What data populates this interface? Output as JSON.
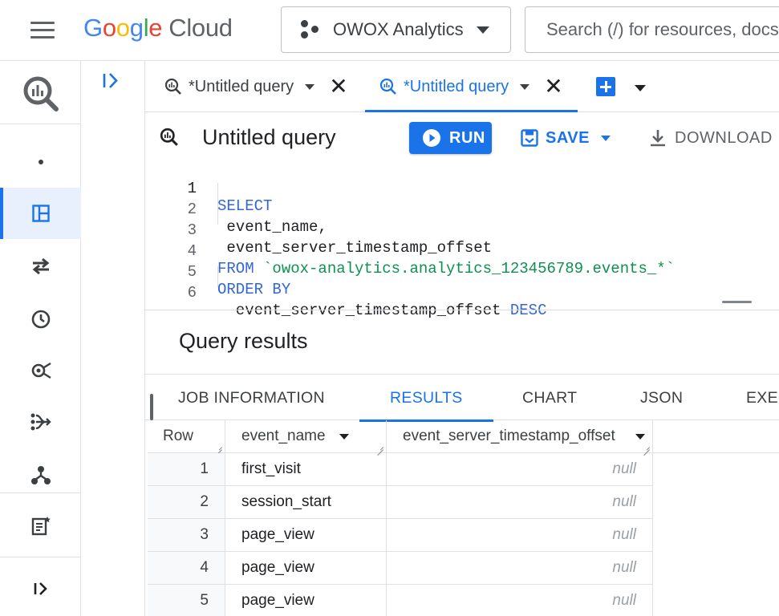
{
  "header": {
    "logo_google": "Google",
    "logo_cloud": "Cloud",
    "project_name": "OWOX Analytics",
    "search_placeholder": "Search (/) for resources, docs"
  },
  "rail": {
    "icons": [
      "bigquery-logo-icon",
      "dot-icon",
      "dashboard-icon",
      "transfers-icon",
      "scheduled-queries-icon",
      "analytics-hub-icon",
      "dataform-icon",
      "pipelines-icon",
      "notes-icon",
      "expand-icon"
    ],
    "active_index": 2
  },
  "tabs": [
    {
      "label": "*Untitled query",
      "active": false
    },
    {
      "label": "*Untitled query",
      "active": true
    }
  ],
  "editor": {
    "title": "Untitled query",
    "run_label": "RUN",
    "save_label": "SAVE",
    "download_label": "DOWNLOAD",
    "lines": [
      {
        "n": "1",
        "text": "SELECT"
      },
      {
        "n": "2",
        "text": " event_name,"
      },
      {
        "n": "3",
        "text": " event_server_timestamp_offset"
      },
      {
        "n": "4",
        "text": "FROM `owox-analytics.analytics_123456789.events_*`"
      },
      {
        "n": "5",
        "text": "ORDER BY"
      },
      {
        "n": "6",
        "text": "  event_server_timestamp_offset DESC"
      }
    ]
  },
  "results": {
    "title": "Query results",
    "tabs": [
      "JOB INFORMATION",
      "RESULTS",
      "CHART",
      "JSON",
      "EXECUTION DETAILS"
    ],
    "active_tab": "RESULTS",
    "columns": [
      "Row",
      "event_name",
      "event_server_timestamp_offset"
    ],
    "rows": [
      {
        "row": "1",
        "event_name": "first_visit",
        "offset": "null"
      },
      {
        "row": "2",
        "event_name": "session_start",
        "offset": "null"
      },
      {
        "row": "3",
        "event_name": "page_view",
        "offset": "null"
      },
      {
        "row": "4",
        "event_name": "page_view",
        "offset": "null"
      },
      {
        "row": "5",
        "event_name": "page_view",
        "offset": "null"
      }
    ]
  },
  "colors": {
    "accent": "#1a73e8",
    "keyword": "#3367d6",
    "string": "#0d904f"
  }
}
